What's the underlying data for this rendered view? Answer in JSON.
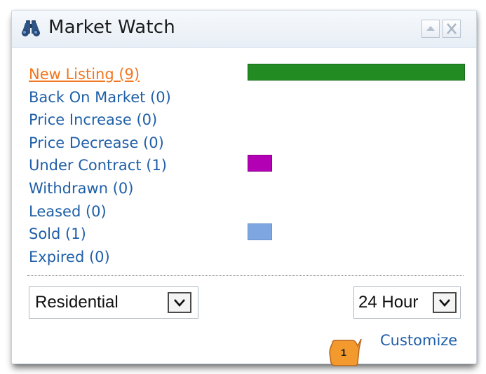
{
  "widget": {
    "title": "Market Watch",
    "icon": "binoculars-icon",
    "header_buttons": [
      "collapse-icon",
      "close-icon"
    ]
  },
  "market_items": [
    {
      "label": "New Listing (9)",
      "count": 9,
      "active": true,
      "bar_color": "#228b22"
    },
    {
      "label": "Back On Market (0)",
      "count": 0
    },
    {
      "label": "Price Increase (0)",
      "count": 0
    },
    {
      "label": "Price Decrease (0)",
      "count": 0
    },
    {
      "label": "Under Contract (1)",
      "count": 1,
      "bar_color": "#b400b4"
    },
    {
      "label": "Withdrawn (0)",
      "count": 0
    },
    {
      "label": "Leased (0)",
      "count": 0
    },
    {
      "label": "Sold (1)",
      "count": 1,
      "bar_color": "#7ea6e0"
    },
    {
      "label": "Expired (0)",
      "count": 0
    }
  ],
  "filters": {
    "property_type": "Residential",
    "time_range": "24 Hour"
  },
  "customize_label": "Customize",
  "callout_number": "1",
  "colors": {
    "link": "#1f5fa8",
    "active_link": "#f2761f",
    "callout": "#f39a2e"
  }
}
